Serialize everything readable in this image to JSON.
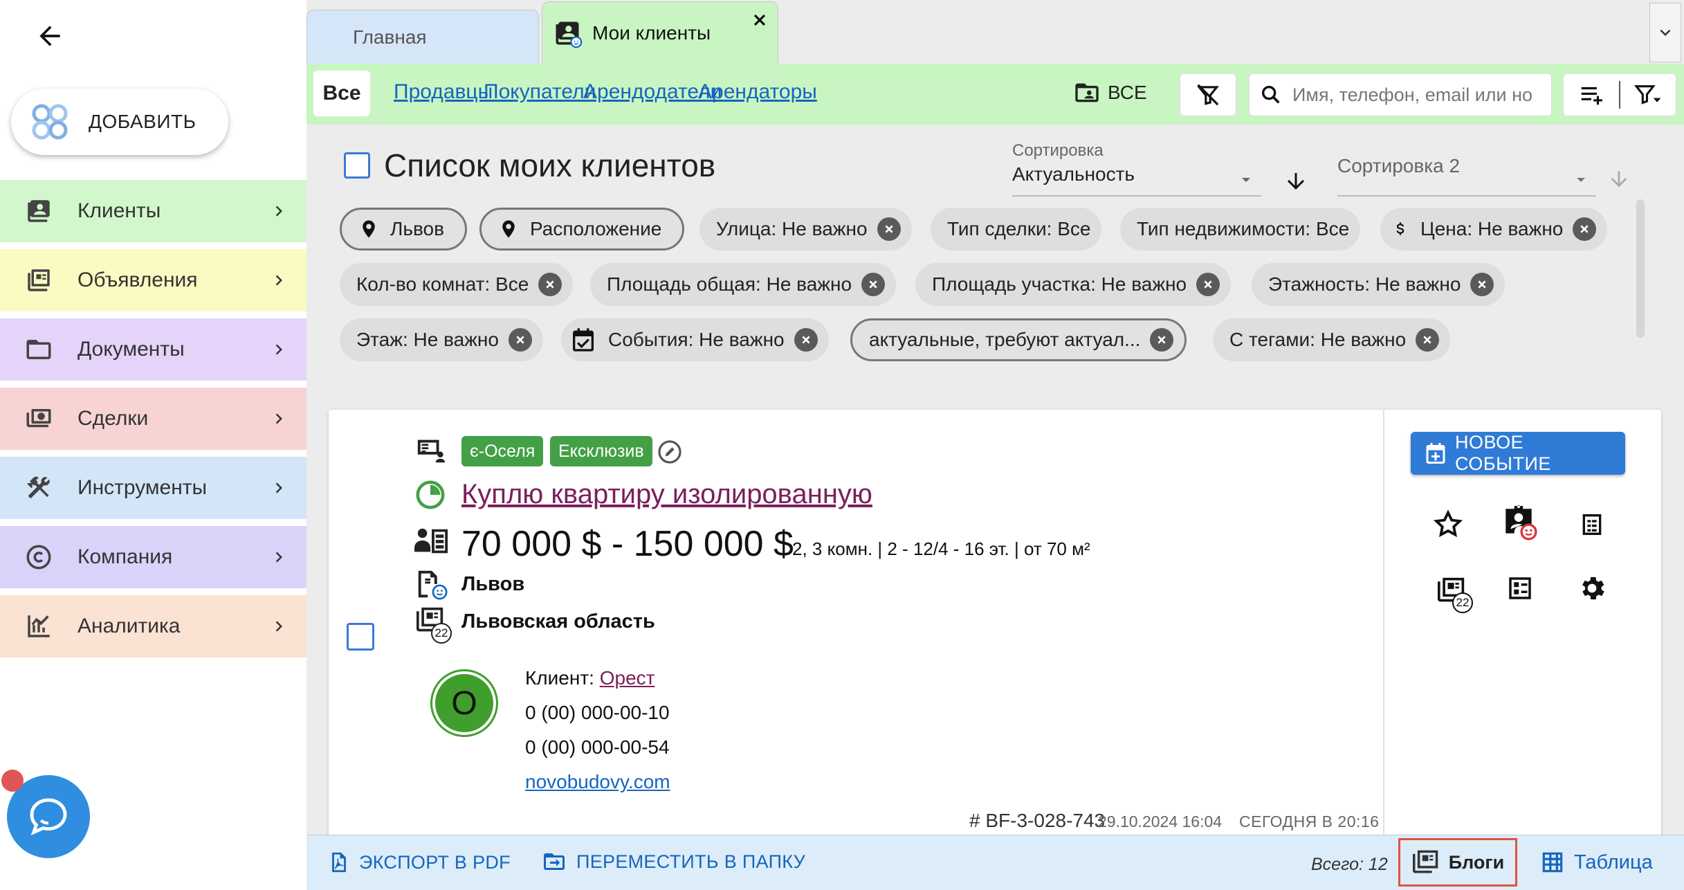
{
  "sidebar": {
    "add_label": "ДОБАВИТЬ",
    "items": [
      {
        "label": "Клиенты",
        "bg": "#d2f7cc",
        "icon": "client-card-icon"
      },
      {
        "label": "Объявления",
        "bg": "#fafac2",
        "icon": "listings-icon"
      },
      {
        "label": "Документы",
        "bg": "#e5d3fa",
        "icon": "folder-icon"
      },
      {
        "label": "Сделки",
        "bg": "#f8d3d3",
        "icon": "money-icon"
      },
      {
        "label": "Инструменты",
        "bg": "#d3e6f8",
        "icon": "tools-icon"
      },
      {
        "label": "Компания",
        "bg": "#d9d3fa",
        "icon": "copyright-icon"
      },
      {
        "label": "Аналитика",
        "bg": "#fae3d3",
        "icon": "analytics-icon"
      }
    ]
  },
  "tabs": {
    "home": "Главная",
    "clients": "Мои клиенты"
  },
  "filterbar": {
    "all": "Все",
    "categories": [
      "Продавцы",
      "Покупатели",
      "Арендодатели",
      "Арендаторы"
    ],
    "folder_all": "ВСЕ",
    "search_placeholder": "Имя, телефон, email или но"
  },
  "list": {
    "title": "Список моих клиентов",
    "sort1_caption": "Сортировка",
    "sort1_value": "Актуальность",
    "sort2_value": "Сортировка 2"
  },
  "chips": [
    "Львов",
    "Расположение",
    "Улица: Не важно",
    "Тип сделки: Все",
    "Тип недвижимости: Все",
    "Цена: Не важно",
    "Кол-во комнат: Все",
    "Площадь общая: Не важно",
    "Площадь участка: Не важно",
    "Этажность: Не важно",
    "Этаж: Не важно",
    "События: Не важно",
    "актуальные, требуют актуал...",
    "С тегами: Не важно"
  ],
  "card": {
    "badges": [
      "є-Оселя",
      "Ексклюзив"
    ],
    "title": "Куплю квартиру изолированную",
    "price": "70 000 $ - 150 000 $",
    "params": "2, 3 комн. | 2 - 12/4 - 16 эт. | от 70 м²",
    "city": "Львов",
    "region": "Львовская область",
    "region_count": "22",
    "avatar_letter": "О",
    "client_label": "Клиент:",
    "client_name": "Орест",
    "phones": [
      "0 (00) 000-00-10",
      "0 (00) 000-00-54"
    ],
    "site": "novobudovy.com",
    "id": "# BF-3-028-743",
    "created": "29.10.2024 16:04",
    "updated": "СЕГОДНЯ В 20:16",
    "new_event": "НОВОЕ СОБЫТИЕ",
    "blog_count": "22"
  },
  "bottombar": {
    "export": "ЭКСПОРТ В PDF",
    "move": "ПЕРЕМЕСТИТЬ В ПАПКУ",
    "total": "Всего: 12",
    "blogs": "Блоги",
    "table": "Таблица"
  },
  "colors": {
    "accent_green": "#c9f5c2",
    "link_blue": "#1565c0",
    "title_purple": "#7b1f5c",
    "badge_green": "#43a047",
    "primary_button": "#2f7bd6"
  }
}
